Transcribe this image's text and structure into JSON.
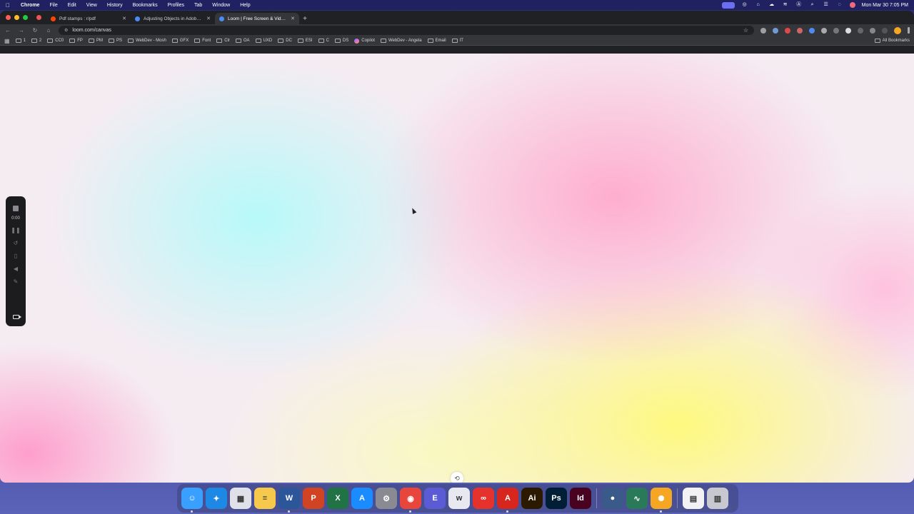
{
  "menubar": {
    "app": "Chrome",
    "items": [
      "File",
      "Edit",
      "View",
      "History",
      "Bookmarks",
      "Profiles",
      "Tab",
      "Window",
      "Help"
    ],
    "clock": "Mon Mar 30  7:05 PM"
  },
  "tabs": [
    {
      "title": "Pdf stamps : r/pdf",
      "favicon_color": "#ff4500",
      "active": false
    },
    {
      "title": "Adjusting Objects in Adobe A",
      "favicon_color": "#4c8bf5",
      "active": false
    },
    {
      "title": "Loom | Free Screen & Video F",
      "favicon_color": "#4c8bf5",
      "active": true
    }
  ],
  "toolbar": {
    "url": "loom.com/canvas"
  },
  "bookmarks": [
    "1",
    "2",
    "CC0",
    "FP",
    "PM",
    "PS",
    "WebDev - Mosh",
    "GFX",
    "Font",
    "Clr",
    "OA",
    "UXD",
    "DC",
    "ESI",
    "C",
    "DS",
    "Copilot",
    "WebDev - Angela",
    "Email",
    "IT"
  ],
  "all_bookmarks": "All Bookmarks",
  "loom": {
    "timer": "0:00"
  },
  "dock": [
    {
      "name": "finder",
      "label": "☺",
      "color": "#3aa0ff",
      "running": true
    },
    {
      "name": "safari",
      "label": "✦",
      "color": "#1e88e5",
      "running": false
    },
    {
      "name": "launchpad",
      "label": "▦",
      "color": "#e0e0e8",
      "running": false
    },
    {
      "name": "notes",
      "label": "≡",
      "color": "#f6c94c",
      "running": false
    },
    {
      "name": "word",
      "label": "W",
      "color": "#2b579a",
      "running": true
    },
    {
      "name": "powerpoint",
      "label": "P",
      "color": "#d04423",
      "running": false
    },
    {
      "name": "excel",
      "label": "X",
      "color": "#217346",
      "running": false
    },
    {
      "name": "app-store",
      "label": "A",
      "color": "#1a8cff",
      "running": false
    },
    {
      "name": "system-settings",
      "label": "⚙",
      "color": "#8a8a92",
      "running": false
    },
    {
      "name": "chrome",
      "label": "◉",
      "color": "#e8453c",
      "running": true
    },
    {
      "name": "editor",
      "label": "E",
      "color": "#5b5bd6",
      "running": false
    },
    {
      "name": "webstorm",
      "label": "w",
      "color": "#e8e8f0",
      "running": false
    },
    {
      "name": "creative-cloud",
      "label": "∞",
      "color": "#e5322d",
      "running": false
    },
    {
      "name": "acrobat",
      "label": "A",
      "color": "#d7261e",
      "running": true
    },
    {
      "name": "illustrator",
      "label": "Ai",
      "color": "#2b1a00",
      "running": false
    },
    {
      "name": "photoshop",
      "label": "Ps",
      "color": "#001e36",
      "running": false
    },
    {
      "name": "indesign",
      "label": "Id",
      "color": "#49021f",
      "running": false
    },
    {
      "name": "disk-utility",
      "label": "●",
      "color": "#3a5a8a",
      "running": false
    },
    {
      "name": "activity-monitor",
      "label": "∿",
      "color": "#2a7a5a",
      "running": false
    },
    {
      "name": "loom",
      "label": "✺",
      "color": "#f5a623",
      "running": true
    },
    {
      "name": "document",
      "label": "▤",
      "color": "#f2f2f4",
      "running": false
    },
    {
      "name": "trash",
      "label": "▥",
      "color": "#c8c8d0",
      "running": false
    }
  ]
}
